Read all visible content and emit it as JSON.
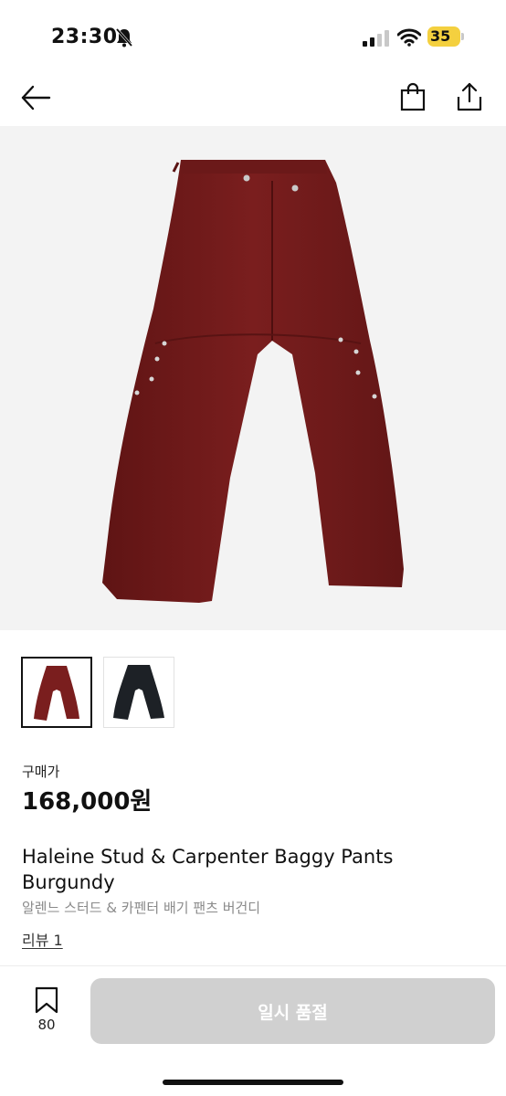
{
  "status_bar": {
    "time": "23:30",
    "battery": "35"
  },
  "nav": {
    "back_icon": "arrow-left-icon",
    "bag_icon": "shopping-bag-icon",
    "share_icon": "share-icon"
  },
  "product": {
    "color_main": "#7a1e1e",
    "thumbnails": [
      {
        "name": "burgundy",
        "color": "#7a1e1e",
        "selected": true
      },
      {
        "name": "black",
        "color": "#1d2126",
        "selected": false
      }
    ],
    "price_label": "구매가",
    "price": "168,000원",
    "title": "Haleine Stud & Carpenter Baggy Pants Burgundy",
    "subtitle": "알렌느 스터드 & 카펜터 배기 팬츠 버건디",
    "review_link": "리뷰 1"
  },
  "bottom_bar": {
    "wishlist_count": "80",
    "cta_label": "일시 품절"
  }
}
